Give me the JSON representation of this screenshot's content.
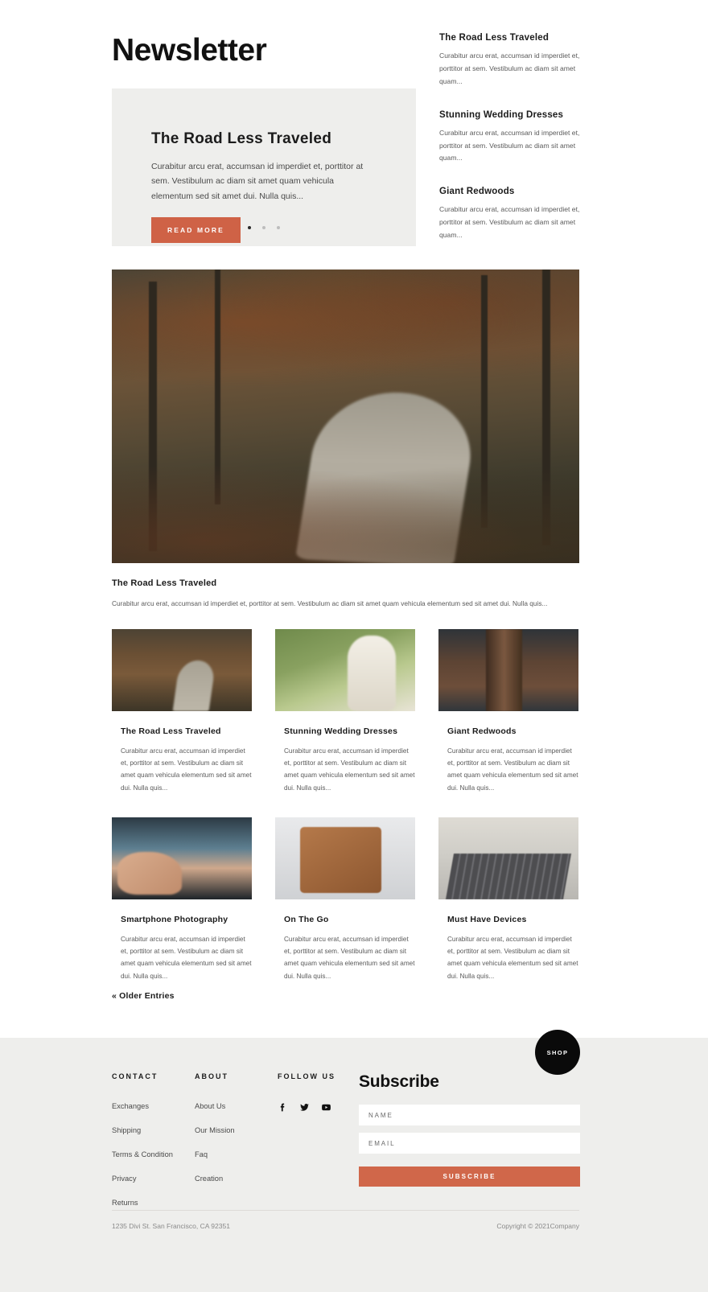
{
  "page_title": "Newsletter",
  "hero": {
    "title": "The Road Less Traveled",
    "excerpt": "Curabitur arcu erat, accumsan id imperdiet et, porttitor at sem. Vestibulum ac diam sit amet quam vehicula elementum sed sit amet dui. Nulla quis...",
    "button_label": "READ MORE",
    "slides": 3,
    "active_slide": 1
  },
  "teasers": [
    {
      "title": "The Road Less Traveled",
      "excerpt": "Curabitur arcu erat, accumsan id imperdiet et, porttitor at sem. Vestibulum ac diam sit amet quam..."
    },
    {
      "title": "Stunning Wedding Dresses",
      "excerpt": "Curabitur arcu erat, accumsan id imperdiet et, porttitor at sem. Vestibulum ac diam sit amet quam..."
    },
    {
      "title": "Giant Redwoods",
      "excerpt": "Curabitur arcu erat, accumsan id imperdiet et, porttitor at sem. Vestibulum ac diam sit amet quam..."
    }
  ],
  "featured": {
    "image_name": "forest-road-autumn-photo",
    "title": "The Road Less Traveled",
    "excerpt": "Curabitur arcu erat, accumsan id imperdiet et, porttitor at sem. Vestibulum ac diam sit amet quam vehicula elementum sed sit amet dui. Nulla quis..."
  },
  "cards_row1": [
    {
      "image_name": "forest-road-thumb",
      "title": "The Road Less Traveled",
      "excerpt": "Curabitur arcu erat, accumsan id imperdiet et, porttitor at sem. Vestibulum ac diam sit amet quam vehicula elementum sed sit amet dui. Nulla quis..."
    },
    {
      "image_name": "wedding-dress-thumb",
      "title": "Stunning Wedding Dresses",
      "excerpt": "Curabitur arcu erat, accumsan id imperdiet et, porttitor at sem. Vestibulum ac diam sit amet quam vehicula elementum sed sit amet dui. Nulla quis..."
    },
    {
      "image_name": "giant-redwoods-thumb",
      "title": "Giant Redwoods",
      "excerpt": "Curabitur arcu erat, accumsan id imperdiet et, porttitor at sem. Vestibulum ac diam sit amet quam vehicula elementum sed sit amet dui. Nulla quis..."
    }
  ],
  "cards_row2": [
    {
      "image_name": "smartphone-photography-thumb",
      "title": "Smartphone Photography",
      "excerpt": "Curabitur arcu erat, accumsan id imperdiet et, porttitor at sem. Vestibulum ac diam sit amet quam vehicula elementum sed sit amet dui. Nulla quis..."
    },
    {
      "image_name": "tablet-phone-desk-thumb",
      "title": "On The Go",
      "excerpt": "Curabitur arcu erat, accumsan id imperdiet et, porttitor at sem. Vestibulum ac diam sit amet quam vehicula elementum sed sit amet dui. Nulla quis..."
    },
    {
      "image_name": "laptop-keyboard-thumb",
      "title": "Must Have Devices",
      "excerpt": "Curabitur arcu erat, accumsan id imperdiet et, porttitor at sem. Vestibulum ac diam sit amet quam vehicula elementum sed sit amet dui. Nulla quis..."
    }
  ],
  "pagination": {
    "older_label": "« Older Entries"
  },
  "footer": {
    "shop_badge": "SHOP",
    "columns": [
      {
        "heading": "CONTACT",
        "links": [
          "Exchanges",
          "Shipping",
          "Terms & Condition",
          "Privacy",
          "Returns"
        ]
      },
      {
        "heading": "ABOUT",
        "links": [
          "About Us",
          "Our Mission",
          "Faq",
          "Creation"
        ]
      }
    ],
    "follow": {
      "heading": "FOLLOW US",
      "icons": [
        "facebook-icon",
        "twitter-icon",
        "youtube-icon"
      ]
    },
    "subscribe": {
      "title": "Subscribe",
      "name_placeholder": "NAME",
      "name_value": "",
      "email_placeholder": "EMAIL",
      "email_value": "",
      "button_label": "SUBSCRIBE"
    },
    "address": "1235 Divi St. San Francisco, CA 92351",
    "copyright": "Copyright © 2021Company"
  },
  "colors": {
    "accent": "#d0674a",
    "panel": "#eeeeec",
    "text": "#1b1b1b",
    "muted": "#5a5a5a",
    "badge": "#0a0a0a"
  }
}
